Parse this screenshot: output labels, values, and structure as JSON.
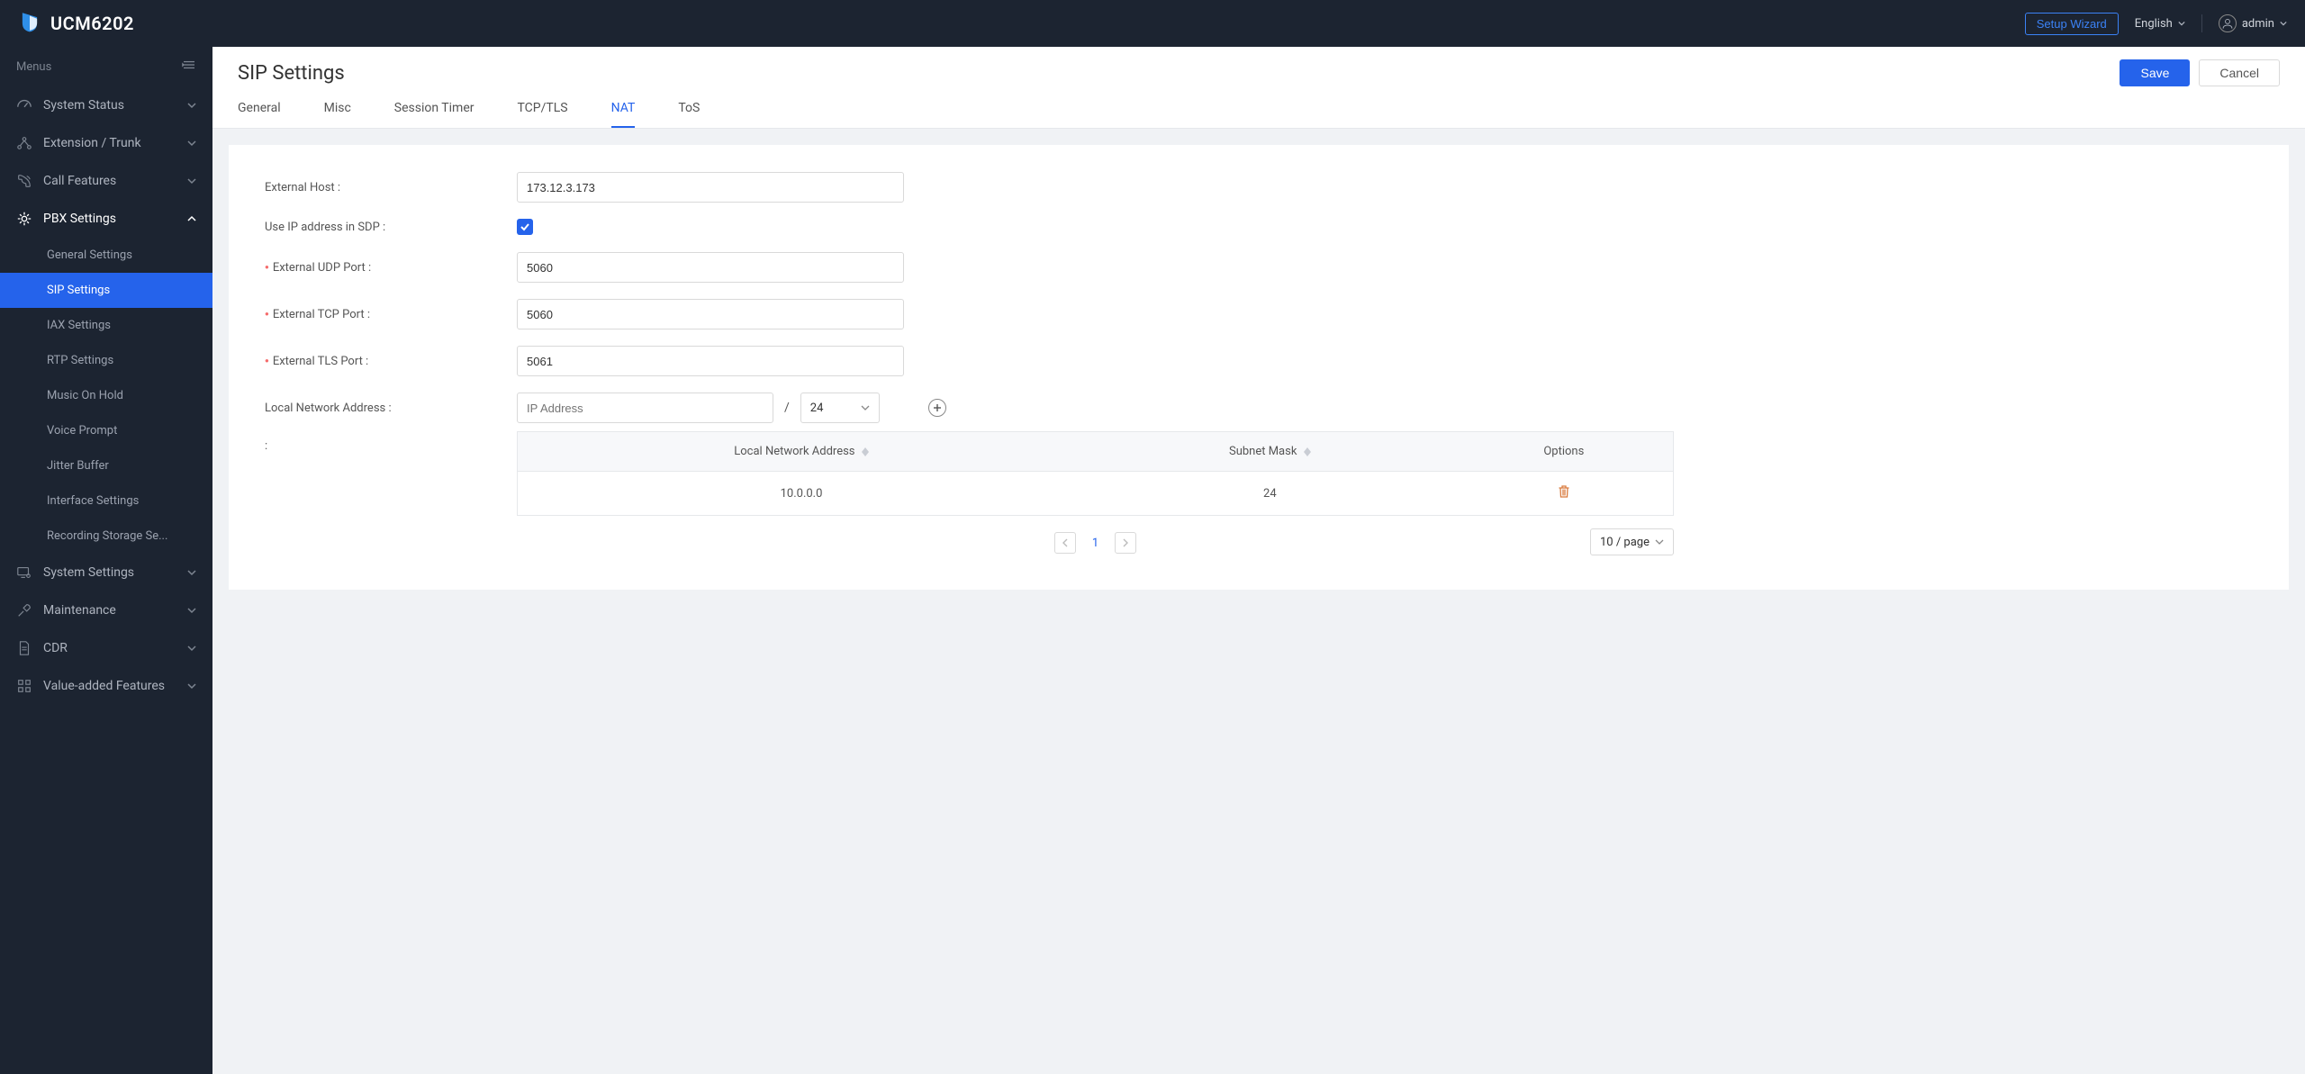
{
  "brand": "UCM6202",
  "header": {
    "setup_wizard": "Setup Wizard",
    "language": "English",
    "user": "admin"
  },
  "sidebar": {
    "menus_label": "Menus",
    "items": [
      {
        "label": "System Status"
      },
      {
        "label": "Extension / Trunk"
      },
      {
        "label": "Call Features"
      },
      {
        "label": "PBX Settings"
      },
      {
        "label": "System Settings"
      },
      {
        "label": "Maintenance"
      },
      {
        "label": "CDR"
      },
      {
        "label": "Value-added Features"
      }
    ],
    "pbx_sub": [
      {
        "label": "General Settings"
      },
      {
        "label": "SIP Settings"
      },
      {
        "label": "IAX Settings"
      },
      {
        "label": "RTP Settings"
      },
      {
        "label": "Music On Hold"
      },
      {
        "label": "Voice Prompt"
      },
      {
        "label": "Jitter Buffer"
      },
      {
        "label": "Interface Settings"
      },
      {
        "label": "Recording Storage Se..."
      }
    ]
  },
  "page": {
    "title": "SIP Settings",
    "save": "Save",
    "cancel": "Cancel"
  },
  "tabs": [
    "General",
    "Misc",
    "Session Timer",
    "TCP/TLS",
    "NAT",
    "ToS"
  ],
  "active_tab": "NAT",
  "form": {
    "external_host_label": "External Host :",
    "external_host_value": "173.12.3.173",
    "use_ip_sdp_label": "Use IP address in SDP :",
    "use_ip_sdp_checked": true,
    "external_udp_label": "External UDP Port :",
    "external_udp_value": "5060",
    "external_tcp_label": "External TCP Port :",
    "external_tcp_value": "5060",
    "external_tls_label": "External TLS Port :",
    "external_tls_value": "5061",
    "local_net_label": "Local Network Address :",
    "ip_placeholder": "IP Address",
    "slash": "/",
    "mask_value": "24",
    "colon_label": ":"
  },
  "table": {
    "col_addr": "Local Network Address",
    "col_mask": "Subnet Mask",
    "col_options": "Options",
    "rows": [
      {
        "addr": "10.0.0.0",
        "mask": "24"
      }
    ]
  },
  "pagination": {
    "current": "1",
    "page_size": "10 / page"
  }
}
